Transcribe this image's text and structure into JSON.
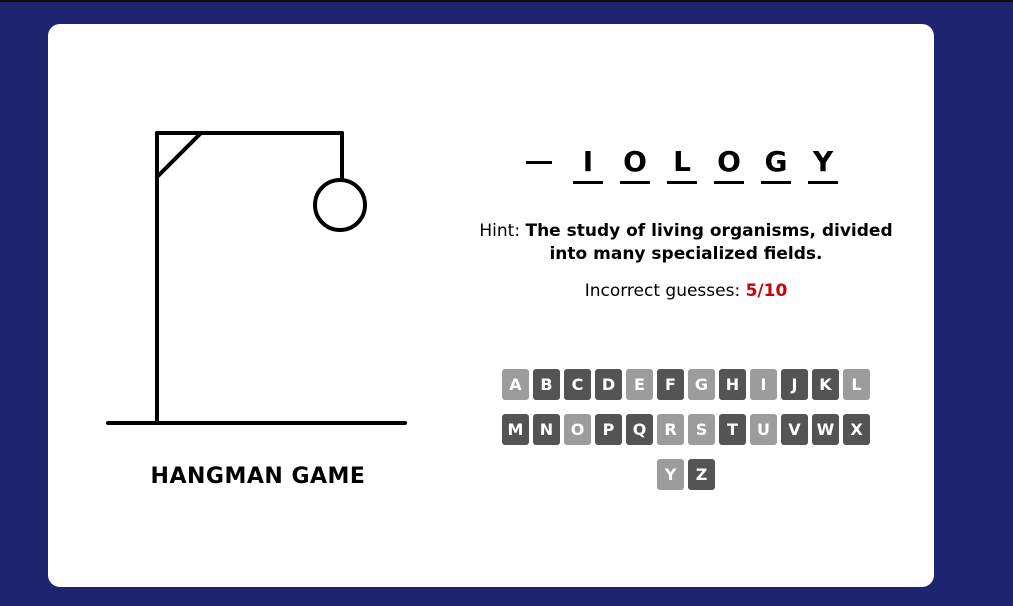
{
  "game": {
    "title": "HANGMAN GAME",
    "word_slots": [
      "",
      "I",
      "O",
      "L",
      "O",
      "G",
      "Y"
    ],
    "hint_label": "Hint:",
    "hint_text": "The study of living organisms, divided into many specialized fields.",
    "guesses_label": "Incorrect guesses:",
    "guesses_value": "5/10",
    "incorrect_count": 5,
    "max_guesses": 10
  },
  "keyboard": {
    "rows": [
      [
        {
          "letter": "A",
          "used": true
        },
        {
          "letter": "B",
          "used": false
        },
        {
          "letter": "C",
          "used": false
        },
        {
          "letter": "D",
          "used": false
        },
        {
          "letter": "E",
          "used": true
        },
        {
          "letter": "F",
          "used": false
        },
        {
          "letter": "G",
          "used": true
        },
        {
          "letter": "H",
          "used": false
        },
        {
          "letter": "I",
          "used": true
        },
        {
          "letter": "J",
          "used": false
        },
        {
          "letter": "K",
          "used": false
        },
        {
          "letter": "L",
          "used": true
        }
      ],
      [
        {
          "letter": "M",
          "used": false
        },
        {
          "letter": "N",
          "used": false
        },
        {
          "letter": "O",
          "used": true
        },
        {
          "letter": "P",
          "used": false
        },
        {
          "letter": "Q",
          "used": false
        },
        {
          "letter": "R",
          "used": true
        },
        {
          "letter": "S",
          "used": true
        },
        {
          "letter": "T",
          "used": false
        },
        {
          "letter": "U",
          "used": true
        },
        {
          "letter": "V",
          "used": false
        },
        {
          "letter": "W",
          "used": false
        },
        {
          "letter": "X",
          "used": false
        }
      ],
      [
        {
          "letter": "Y",
          "used": true
        },
        {
          "letter": "Z",
          "used": false
        }
      ]
    ]
  },
  "colors": {
    "background": "#1f2470",
    "card": "#ffffff",
    "key_active": "#545454",
    "key_used": "#9c9c9c",
    "guess_count": "#c8000a"
  }
}
